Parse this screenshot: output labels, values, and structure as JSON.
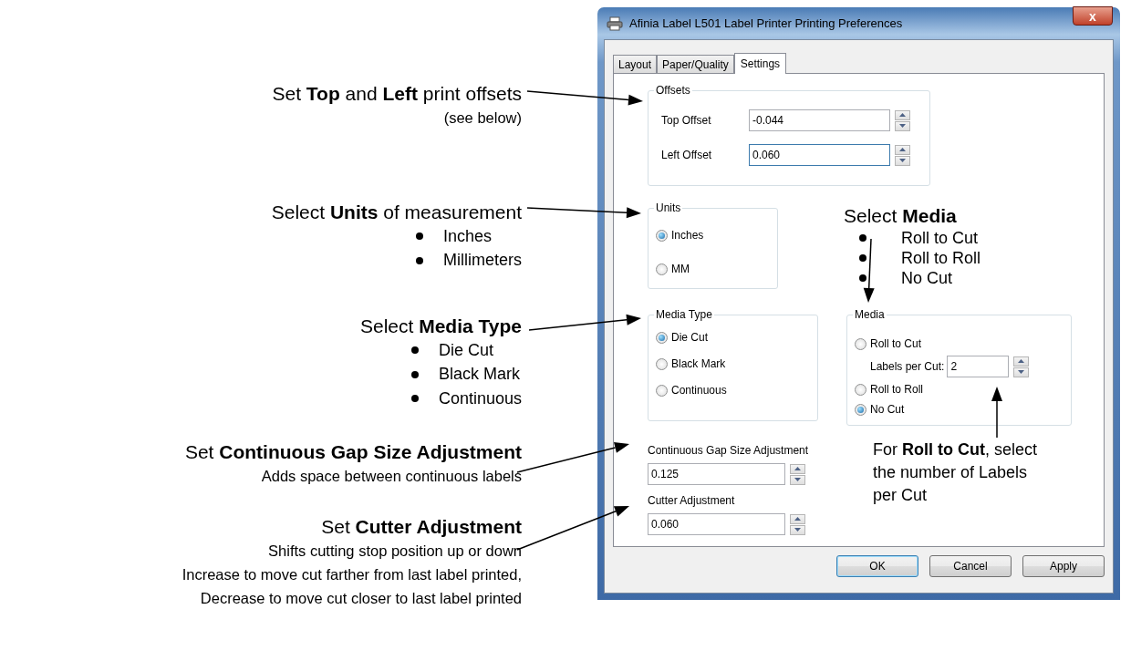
{
  "annotations": [
    {
      "heading": "Set **Top** and **Left** print offsets",
      "lines": [
        "(see below)"
      ]
    },
    {
      "heading": "Select **Units** of measurement",
      "bullets": [
        "Inches",
        "Millimeters"
      ]
    },
    {
      "heading": "Select **Media Type**",
      "bullets": [
        "Die Cut",
        "Black Mark",
        "Continuous"
      ]
    },
    {
      "heading": "Set **Continuous Gap Size Adjustment**",
      "lines": [
        "Adds space between continuous labels"
      ]
    },
    {
      "heading": "Set **Cutter Adjustment**",
      "lines": [
        "Shifts cutting stop position up or down",
        "Increase to move cut farther from last label printed,",
        "Decrease to move cut closer to last label printed"
      ]
    }
  ],
  "media_callout": {
    "heading": "Select **Media**",
    "bullets": [
      "Roll to Cut",
      "Roll to Roll",
      "No Cut"
    ]
  },
  "roll_callout": {
    "text": "For **Roll to Cut**, select the number of Labels per Cut"
  },
  "dialog": {
    "title": "Afinia Label L501 Label Printer Printing Preferences",
    "close": "x",
    "tabs": [
      {
        "label": "Layout",
        "selected": false
      },
      {
        "label": "Paper/Quality",
        "selected": false
      },
      {
        "label": "Settings",
        "selected": true
      }
    ],
    "offsets": {
      "title": "Offsets",
      "fields": [
        {
          "label": "Top Offset",
          "value": "-0.044",
          "focused": false
        },
        {
          "label": "Left Offset",
          "value": "0.060",
          "focused": true
        }
      ]
    },
    "units": {
      "title": "Units",
      "options": [
        {
          "label": "Inches",
          "selected": true
        },
        {
          "label": "MM",
          "selected": false
        }
      ]
    },
    "media_type": {
      "title": "Media Type",
      "options": [
        {
          "label": "Die Cut",
          "selected": true
        },
        {
          "label": "Black Mark",
          "selected": false
        },
        {
          "label": "Continuous",
          "selected": false
        }
      ]
    },
    "media": {
      "title": "Media",
      "options": [
        {
          "label": "Roll to Cut",
          "selected": false
        },
        {
          "label": "Roll to Roll",
          "selected": false
        },
        {
          "label": "No Cut",
          "selected": true
        }
      ],
      "labels_per_cut": {
        "label": "Labels per Cut:",
        "value": "2"
      }
    },
    "gap": {
      "label": "Continuous Gap Size Adjustment",
      "value": "0.125"
    },
    "cutter": {
      "label": "Cutter Adjustment",
      "value": "0.060"
    },
    "buttons": [
      {
        "label": "OK",
        "default": true
      },
      {
        "label": "Cancel",
        "default": false
      },
      {
        "label": "Apply",
        "default": false
      }
    ]
  }
}
